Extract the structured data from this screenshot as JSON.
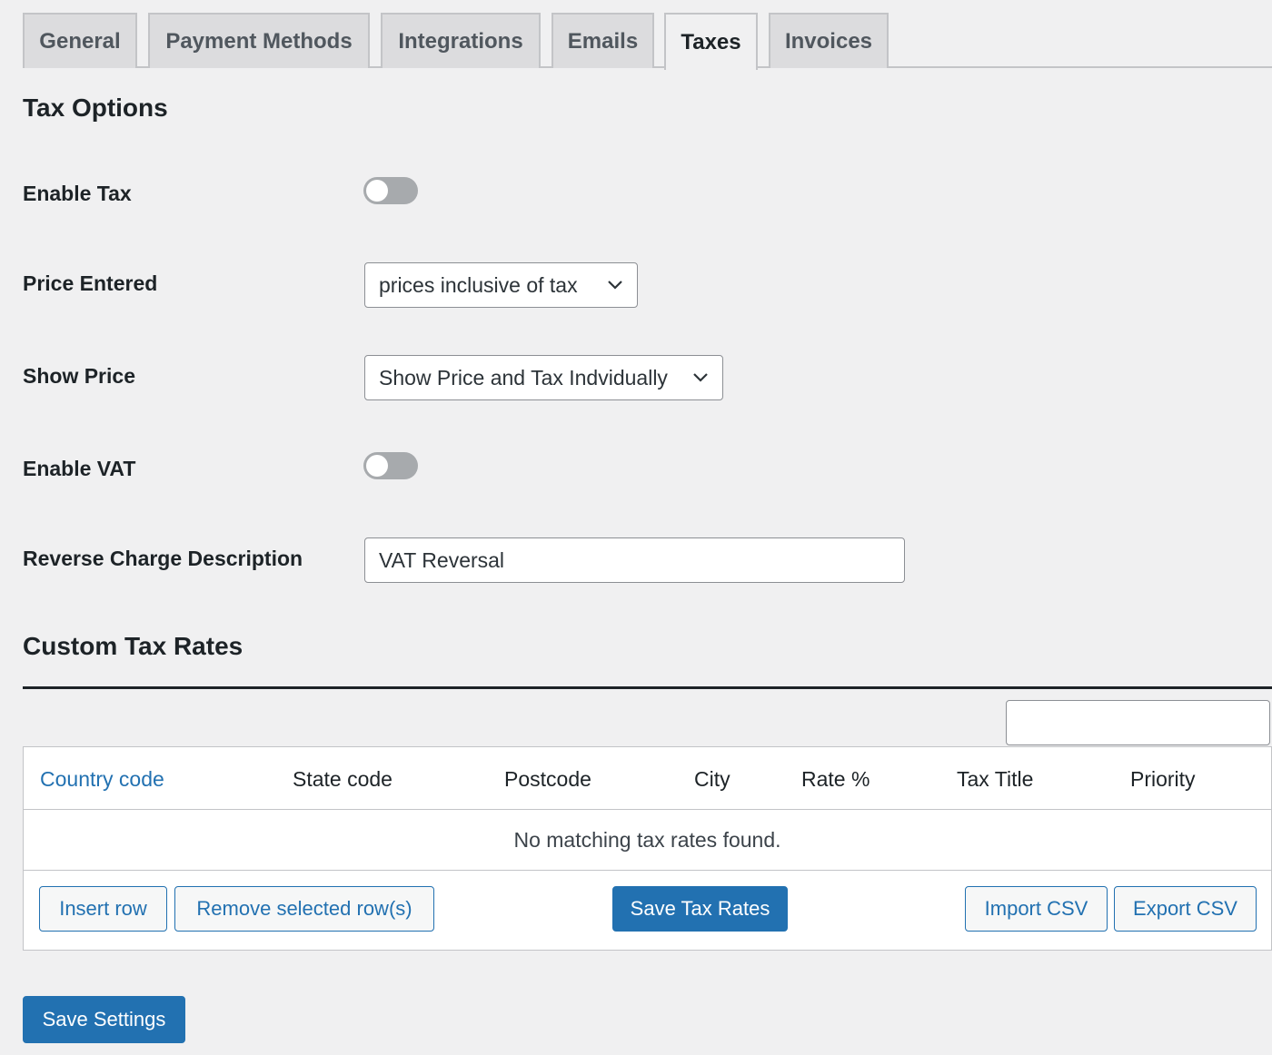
{
  "tabs": [
    {
      "label": "General"
    },
    {
      "label": "Payment Methods"
    },
    {
      "label": "Integrations"
    },
    {
      "label": "Emails"
    },
    {
      "label": "Taxes",
      "active": true
    },
    {
      "label": "Invoices"
    }
  ],
  "tax_options": {
    "title": "Tax Options",
    "enable_tax": {
      "label": "Enable Tax",
      "enabled": false
    },
    "price_entered": {
      "label": "Price Entered",
      "value": "prices inclusive of tax"
    },
    "show_price": {
      "label": "Show Price",
      "value": "Show Price and Tax Indvidually"
    },
    "enable_vat": {
      "label": "Enable VAT",
      "enabled": false
    },
    "reverse_charge": {
      "label": "Reverse Charge Description",
      "value": "VAT Reversal"
    }
  },
  "custom_tax_rates": {
    "title": "Custom Tax Rates",
    "search_value": "",
    "columns": [
      "Country code",
      "State code",
      "Postcode",
      "City",
      "Rate %",
      "Tax Title",
      "Priority"
    ],
    "empty_message": "No matching tax rates found.",
    "buttons": {
      "insert_row": "Insert row",
      "remove_rows": "Remove selected row(s)",
      "save_rates": "Save Tax Rates",
      "import_csv": "Import CSV",
      "export_csv": "Export CSV"
    }
  },
  "save_settings": "Save Settings",
  "colors": {
    "accent": "#2271b1",
    "background": "#f0f0f1"
  }
}
